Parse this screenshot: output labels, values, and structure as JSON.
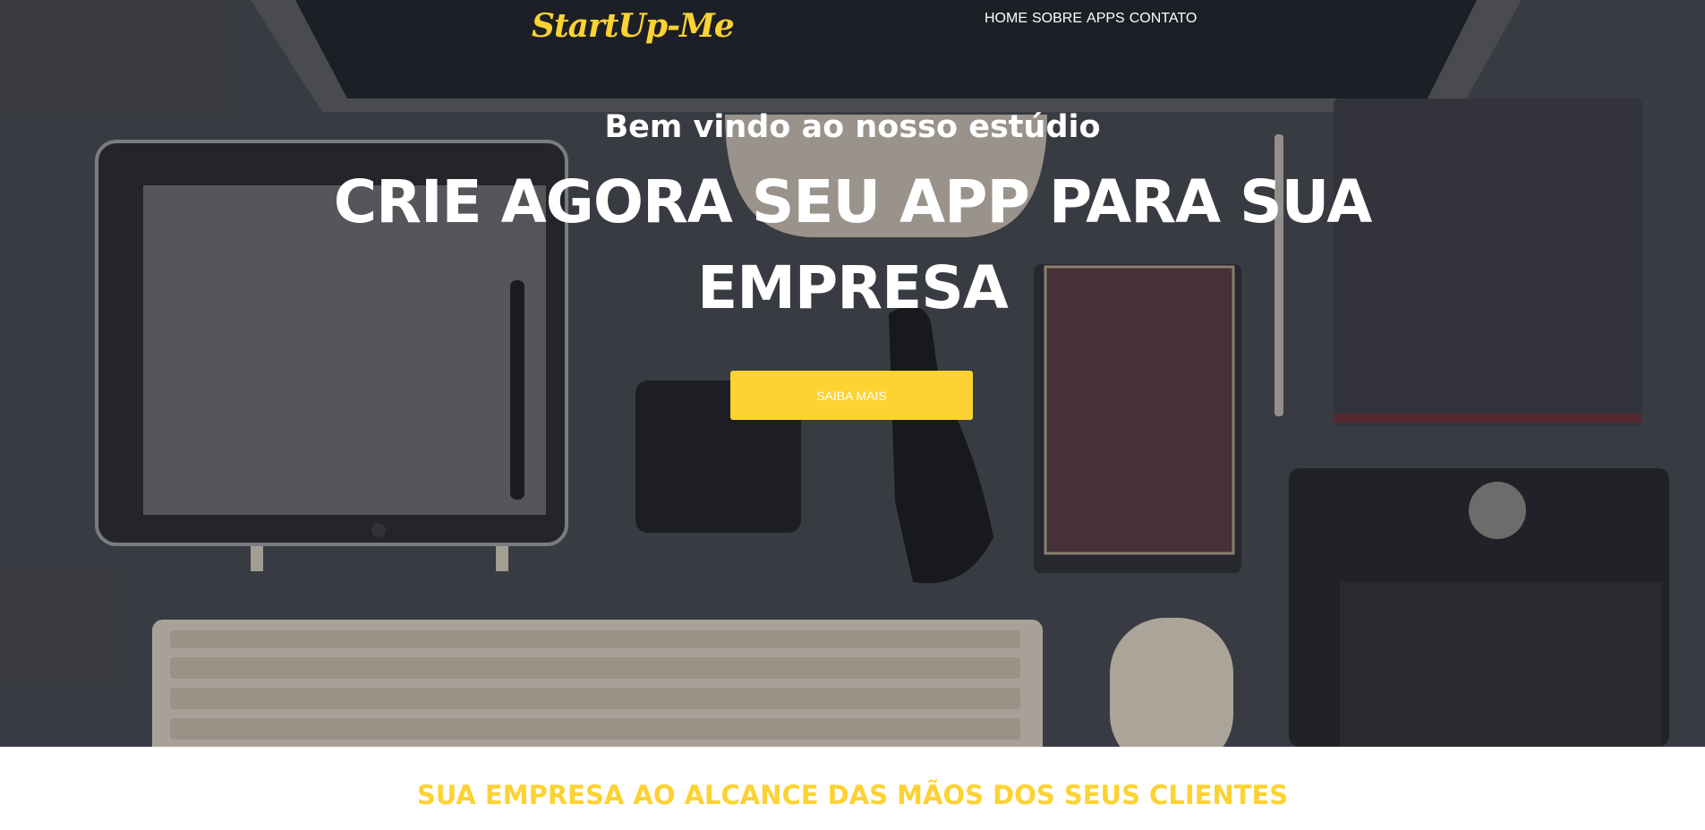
{
  "brand": {
    "logo": "StartUp-Me",
    "accent_color": "#fdd232"
  },
  "nav": {
    "items": [
      "HOME",
      "SOBRE",
      "APPS",
      "CONTATO"
    ]
  },
  "hero": {
    "welcome": "Bem vindo ao nosso estúdio",
    "headline": "CRIE AGORA SEU APP PARA SUA EMPRESA",
    "cta_label": "SAIBA MAIS",
    "background_image": "desk-flatlay-photo"
  },
  "section": {
    "title": "SUA EMPRESA AO ALCANCE DAS MÃOS DOS SEUS CLIENTES"
  }
}
